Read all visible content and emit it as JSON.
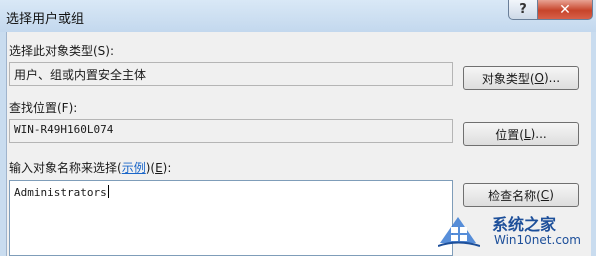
{
  "window": {
    "title": "选择用户或组",
    "help_label": "?",
    "close_label": "✕"
  },
  "object_type": {
    "label": "选择此对象类型(S):",
    "value": "用户、组或内置安全主体",
    "button_prefix": "对象类型(",
    "button_key": "O",
    "button_suffix": ")..."
  },
  "location": {
    "label": "查找位置(F):",
    "value": "WIN-R49H160L074",
    "button_prefix": "位置(",
    "button_key": "L",
    "button_suffix": ")..."
  },
  "names": {
    "label_prefix": "输入对象名称来选择(",
    "label_link": "示例",
    "label_middle": ")(",
    "label_key": "E",
    "label_suffix": "):",
    "value": "Administrators",
    "check_button_prefix": "检查名称(",
    "check_button_key": "C",
    "check_button_suffix": ")"
  },
  "watermark": {
    "title": "系统之家",
    "url": "Win10net.com",
    "logo_icon": "windows-logo-icon"
  }
}
